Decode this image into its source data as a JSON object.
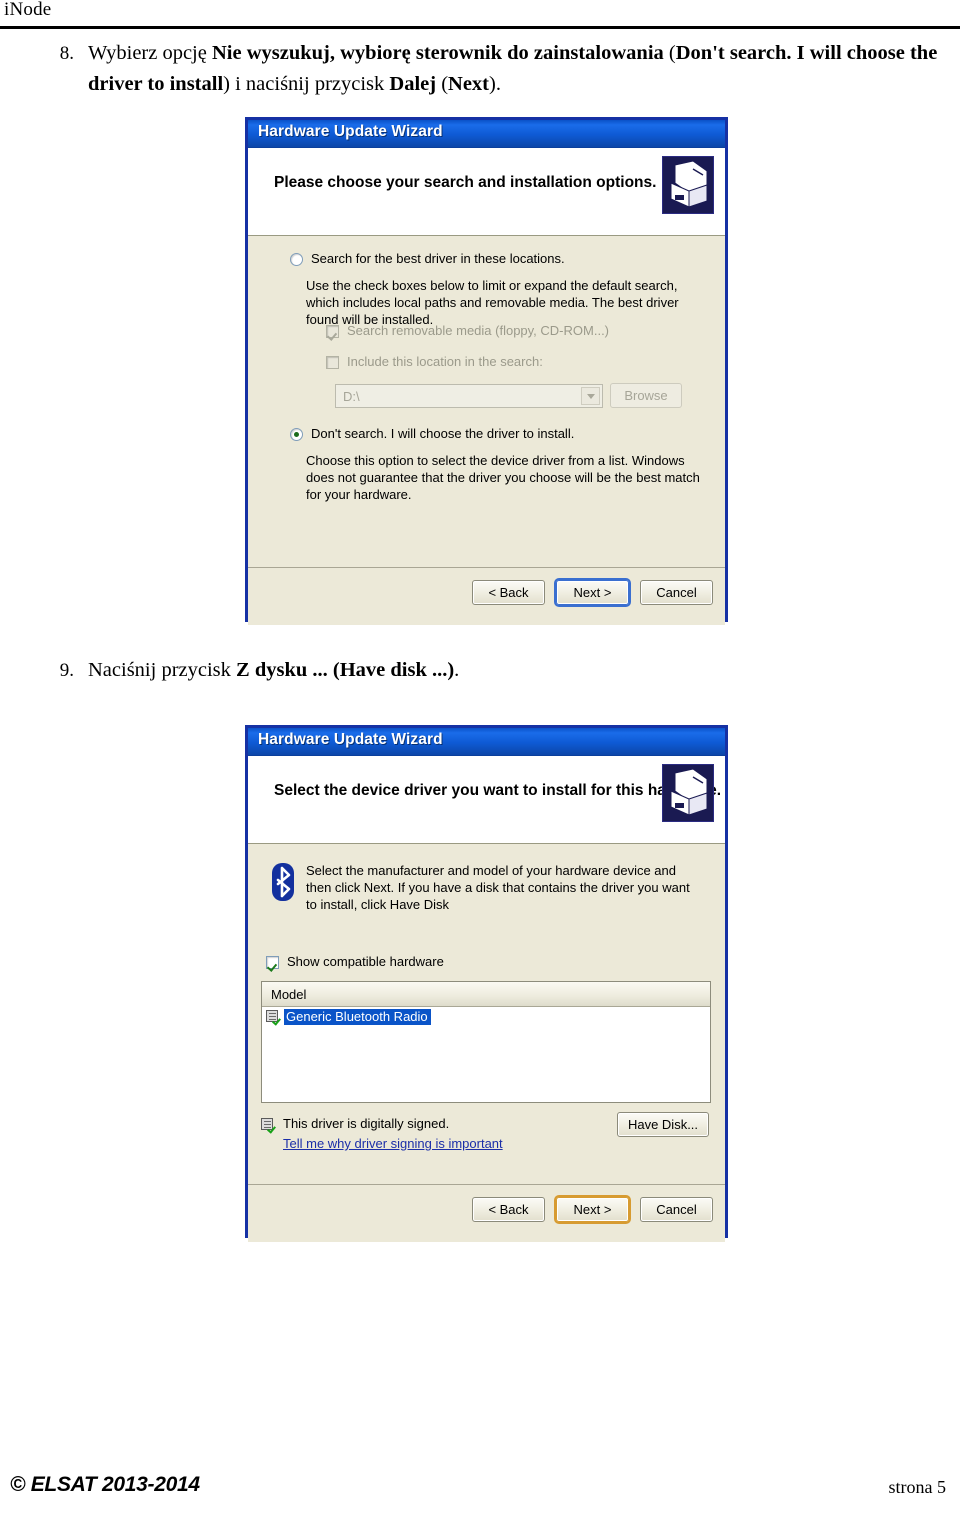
{
  "page": {
    "header_label": "iNode",
    "footer_copyright": "© ELSAT 2013-2014",
    "footer_page": "strona 5"
  },
  "steps": [
    {
      "number": "8.",
      "text_parts": [
        {
          "text": "Wybierz opcję ",
          "bold": false
        },
        {
          "text": "Nie wyszukuj, wybiorę sterownik do zainstalowania",
          "bold": true
        },
        {
          "text": " (",
          "bold": false
        },
        {
          "text": "Don't search. I will choose the driver to install",
          "bold": true
        },
        {
          "text": ") i naciśnij przycisk ",
          "bold": false
        },
        {
          "text": "Dalej",
          "bold": true
        },
        {
          "text": " (",
          "bold": false
        },
        {
          "text": "Next",
          "bold": true
        },
        {
          "text": ").",
          "bold": false
        }
      ],
      "plain": "Wybierz opcję Nie wyszukuj, wybiorę sterownik do zainstalowania (Don't search. I will choose the driver to install) i naciśnij przycisk Dalej (Next)."
    },
    {
      "number": "9.",
      "text_parts": [
        {
          "text": "Naciśnij przycisk ",
          "bold": false
        },
        {
          "text": "Z dysku ... (Have disk ...)",
          "bold": true
        },
        {
          "text": ".",
          "bold": false
        }
      ],
      "plain": "Naciśnij przycisk Z dysku ... (Have disk ...)."
    }
  ],
  "dialog1": {
    "title": "Hardware Update Wizard",
    "banner_title": "Please choose your search and installation options.",
    "icon": "hardware-wizard-icon",
    "option_search": {
      "label": "Search for the best driver in these locations.",
      "selected": false
    },
    "search_description": "Use the check boxes below to limit or expand the default search, which includes local paths and removable media. The best driver found will be installed.",
    "checkbox_removable": {
      "label": "Search removable media (floppy, CD-ROM...)",
      "checked": true,
      "disabled": true
    },
    "checkbox_location": {
      "label": "Include this location in the search:",
      "checked": false,
      "disabled": true
    },
    "location_combo": {
      "value": "D:\\",
      "disabled": true
    },
    "browse_button": {
      "label": "Browse",
      "disabled": true
    },
    "option_dont_search": {
      "label": "Don't search. I will choose the driver to install.",
      "selected": true
    },
    "dont_search_description": "Choose this option to select the device driver from a list.  Windows does not guarantee that the driver you choose will be the best match for your hardware.",
    "buttons": {
      "back": "< Back",
      "next": "Next >",
      "cancel": "Cancel",
      "focused": "next",
      "focus_color": "#3a6fd0"
    }
  },
  "dialog2": {
    "title": "Hardware Update Wizard",
    "banner_title": "Select the device driver you want to install for this hardware.",
    "icon": "hardware-wizard-icon",
    "device_icon": "bluetooth-icon",
    "instructions": "Select the manufacturer and model of your hardware device and then click Next. If you have a disk that contains the driver you want to install, click Have Disk",
    "checkbox_compatible": {
      "label": "Show compatible hardware",
      "checked": true
    },
    "model_list": {
      "column_header": "Model",
      "rows": [
        {
          "label": "Generic Bluetooth Radio",
          "selected": true,
          "icon": "signed-driver-icon"
        }
      ]
    },
    "signing": {
      "icon": "signed-driver-icon",
      "status_text": "This driver is digitally signed.",
      "link_text": "Tell me why driver signing is important",
      "link_color": "#1b2ea8"
    },
    "have_disk_button": "Have Disk...",
    "buttons": {
      "back": "< Back",
      "next": "Next >",
      "cancel": "Cancel",
      "focused": "next",
      "focus_color": "#d79b31"
    }
  },
  "colors": {
    "titlebar_blue": "#0e5ad4",
    "dialog_border": "#1631a4",
    "dialog_face": "#ece9d8",
    "selection_blue": "#0a54c8",
    "bluetooth_blue": "#13309e"
  }
}
